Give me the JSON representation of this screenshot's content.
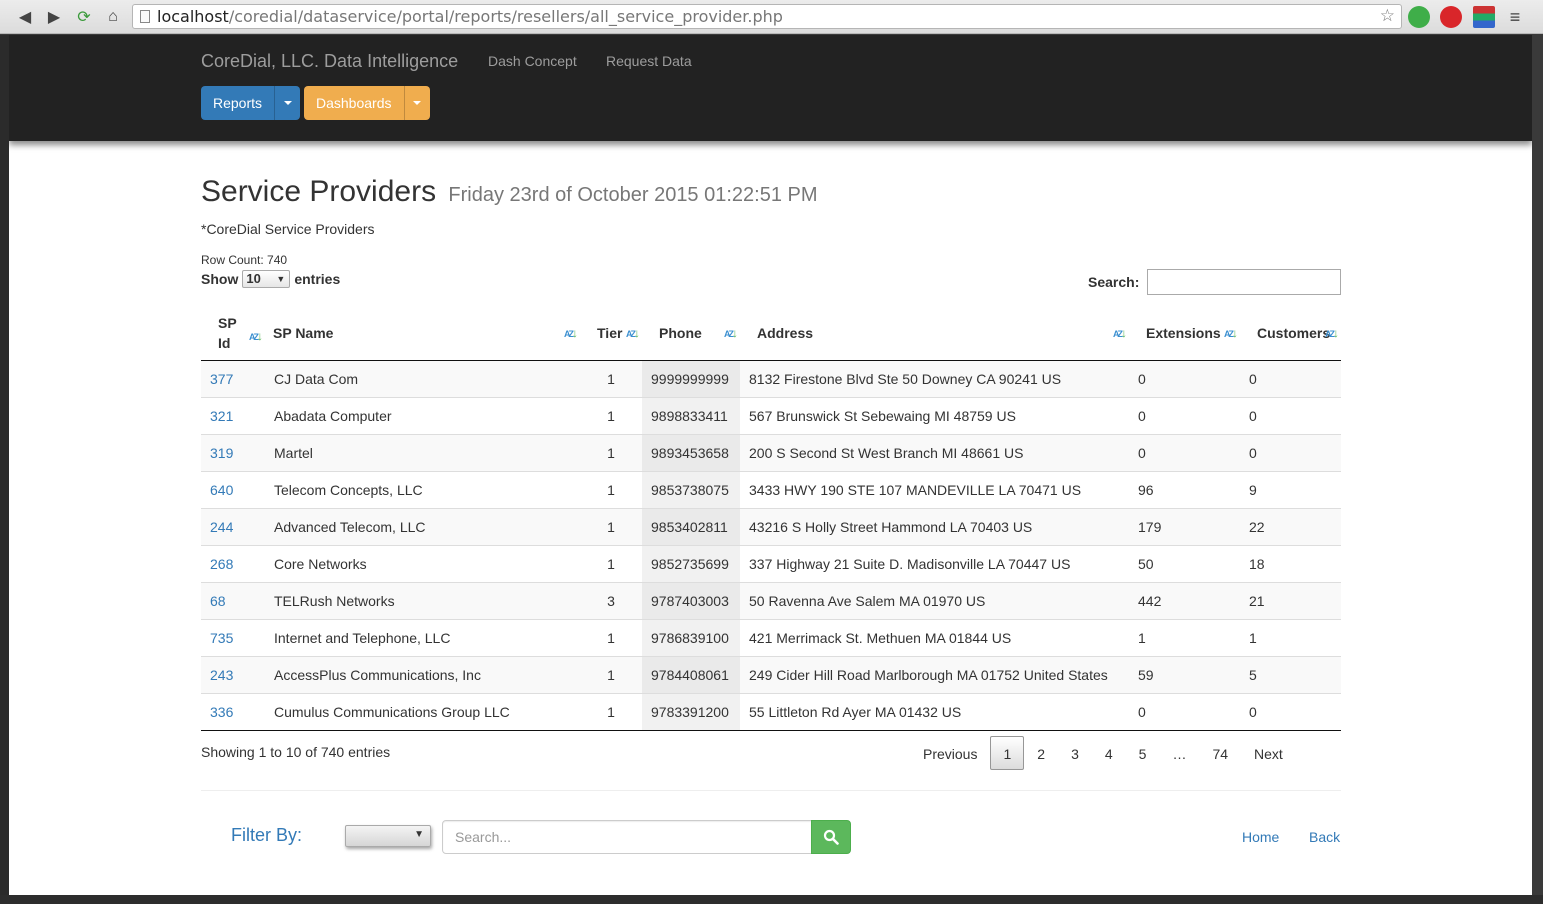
{
  "browser": {
    "url_host": "localhost",
    "url_path": "/coredial/dataservice/portal/reports/resellers/all_service_provider.php"
  },
  "navbar": {
    "brand": "CoreDial, LLC. Data Intelligence",
    "links": [
      "Dash Concept",
      "Request Data"
    ],
    "reports_label": "Reports",
    "dashboards_label": "Dashboards",
    "colors": {
      "background": "#222222",
      "reports": "#337ab7",
      "dashboards": "#f0ad4e"
    }
  },
  "page": {
    "title": "Service Providers",
    "timestamp": "Friday 23rd of October 2015 01:22:51 PM",
    "subtitle": "*CoreDial Service Providers",
    "row_count": "Row Count: 740",
    "show_label": "Show",
    "entries_label": "entries",
    "show_value": "10",
    "search_label": "Search:"
  },
  "table": {
    "headers": {
      "sp_id_line1": "SP",
      "sp_id_line2": "Id",
      "sp_name": "SP Name",
      "tier": "Tier",
      "phone": "Phone",
      "address": "Address",
      "extensions": "Extensions",
      "customers": "Customers"
    },
    "rows": [
      {
        "id": "377",
        "name": "CJ Data Com",
        "tier": "1",
        "phone": "9999999999",
        "address": "8132 Firestone Blvd Ste 50 Downey CA 90241 US",
        "extensions": "0",
        "customers": "0"
      },
      {
        "id": "321",
        "name": "Abadata Computer",
        "tier": "1",
        "phone": "9898833411",
        "address": "567 Brunswick St Sebewaing MI 48759 US",
        "extensions": "0",
        "customers": "0"
      },
      {
        "id": "319",
        "name": "Martel",
        "tier": "1",
        "phone": "9893453658",
        "address": "200 S Second St West Branch MI 48661 US",
        "extensions": "0",
        "customers": "0"
      },
      {
        "id": "640",
        "name": "Telecom Concepts, LLC",
        "tier": "1",
        "phone": "9853738075",
        "address": "3433 HWY 190 STE 107 MANDEVILLE LA 70471 US",
        "extensions": "96",
        "customers": "9"
      },
      {
        "id": "244",
        "name": "Advanced Telecom, LLC",
        "tier": "1",
        "phone": "9853402811",
        "address": "43216 S Holly Street Hammond LA 70403 US",
        "extensions": "179",
        "customers": "22"
      },
      {
        "id": "268",
        "name": "Core Networks",
        "tier": "1",
        "phone": "9852735699",
        "address": "337 Highway 21 Suite D. Madisonville LA 70447 US",
        "extensions": "50",
        "customers": "18"
      },
      {
        "id": "68",
        "name": "TELRush Networks",
        "tier": "3",
        "phone": "9787403003",
        "address": "50 Ravenna Ave Salem MA 01970 US",
        "extensions": "442",
        "customers": "21"
      },
      {
        "id": "735",
        "name": "Internet and Telephone, LLC",
        "tier": "1",
        "phone": "9786839100",
        "address": "421 Merrimack St. Methuen MA 01844 US",
        "extensions": "1",
        "customers": "1"
      },
      {
        "id": "243",
        "name": "AccessPlus Communications, Inc",
        "tier": "1",
        "phone": "9784408061",
        "address": "249 Cider Hill Road Marlborough MA 01752 United States",
        "extensions": "59",
        "customers": "5"
      },
      {
        "id": "336",
        "name": "Cumulus Communications Group LLC",
        "tier": "1",
        "phone": "9783391200",
        "address": "55 Littleton Rd Ayer MA 01432 US",
        "extensions": "0",
        "customers": "0"
      }
    ]
  },
  "pagination": {
    "info": "Showing 1 to 10 of 740 entries",
    "previous": "Previous",
    "pages": [
      "1",
      "2",
      "3",
      "4",
      "5",
      "…",
      "74"
    ],
    "next": "Next",
    "active_page": "1"
  },
  "filter": {
    "label": "Filter By:",
    "placeholder": "Search...",
    "home": "Home",
    "back": "Back"
  }
}
